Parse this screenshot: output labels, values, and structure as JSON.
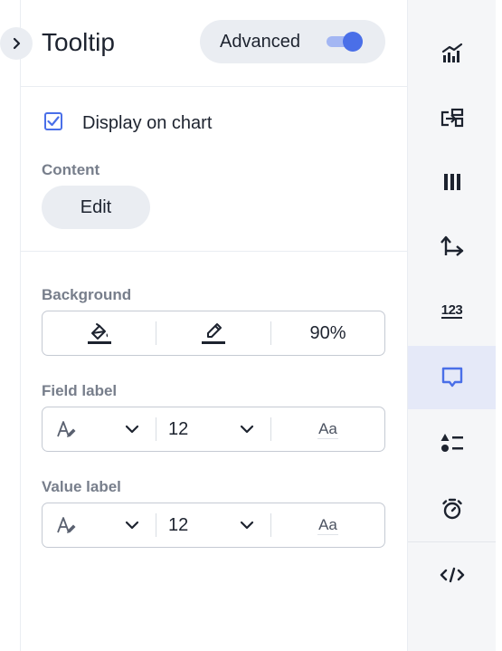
{
  "panel": {
    "title": "Tooltip",
    "advanced_label": "Advanced",
    "advanced_enabled": true,
    "display_on_chart_label": "Display on chart",
    "display_on_chart_checked": true,
    "content_label": "Content",
    "edit_label": "Edit"
  },
  "background": {
    "label": "Background",
    "opacity": "90%"
  },
  "field_label": {
    "label": "Field label",
    "font_size": "12",
    "case_sample": "Aa"
  },
  "value_label": {
    "label": "Value label",
    "font_size": "12",
    "case_sample": "Aa"
  },
  "rail": {
    "items": [
      {
        "icon": "chart-type-icon",
        "active": false
      },
      {
        "icon": "data-transfer-icon",
        "active": false
      },
      {
        "icon": "columns-icon",
        "active": false
      },
      {
        "icon": "axes-icon",
        "active": false
      },
      {
        "icon": "number-format-icon",
        "text": "123",
        "active": false
      },
      {
        "icon": "tooltip-icon",
        "active": true
      },
      {
        "icon": "legend-list-icon",
        "active": false
      },
      {
        "icon": "timer-icon",
        "active": false
      },
      {
        "icon": "code-icon",
        "active": false
      }
    ]
  },
  "colors": {
    "accent": "#4a6fe8",
    "active_rail_bg": "#e5e9f8",
    "pill_bg": "#eaedf2",
    "section_label": "#777e8b"
  }
}
